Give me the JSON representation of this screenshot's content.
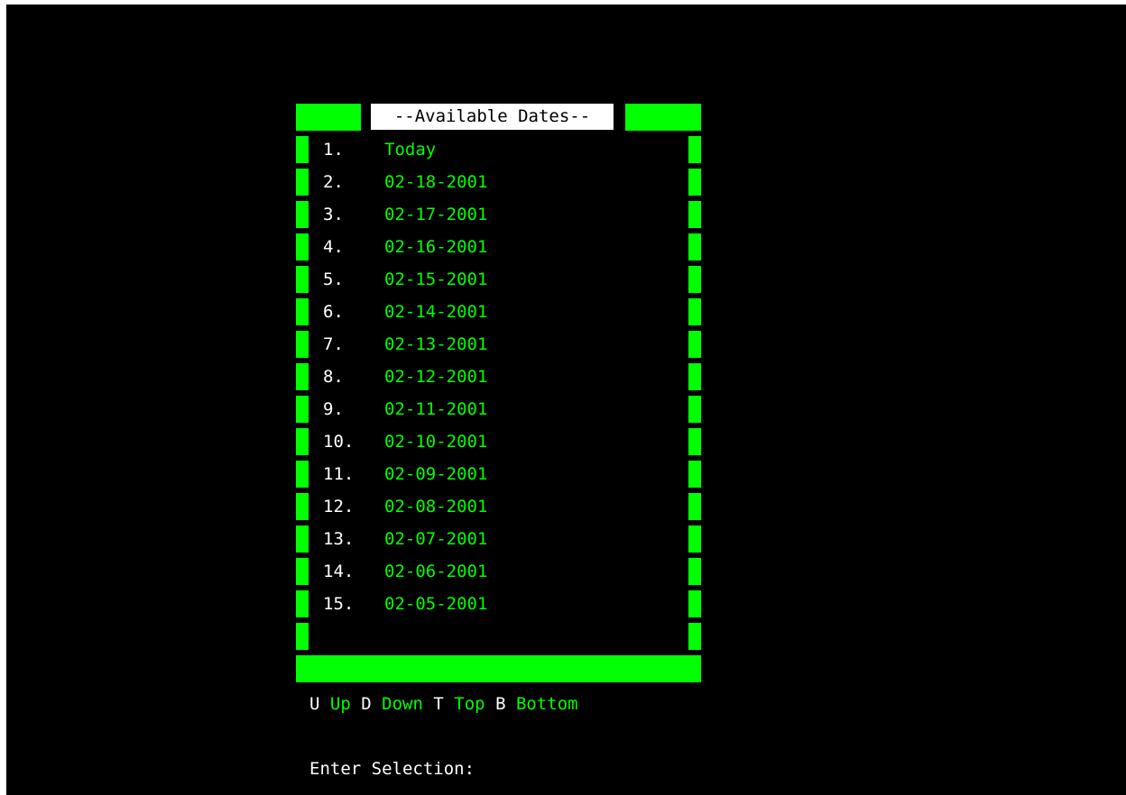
{
  "title": "--Available Dates--",
  "items": [
    {
      "num": "1.",
      "date": "Today"
    },
    {
      "num": "2.",
      "date": "02-18-2001"
    },
    {
      "num": "3.",
      "date": "02-17-2001"
    },
    {
      "num": "4.",
      "date": "02-16-2001"
    },
    {
      "num": "5.",
      "date": "02-15-2001"
    },
    {
      "num": "6.",
      "date": "02-14-2001"
    },
    {
      "num": "7.",
      "date": "02-13-2001"
    },
    {
      "num": "8.",
      "date": "02-12-2001"
    },
    {
      "num": "9.",
      "date": "02-11-2001"
    },
    {
      "num": "10.",
      "date": "02-10-2001"
    },
    {
      "num": "11.",
      "date": "02-09-2001"
    },
    {
      "num": "12.",
      "date": "02-08-2001"
    },
    {
      "num": "13.",
      "date": "02-07-2001"
    },
    {
      "num": "14.",
      "date": "02-06-2001"
    },
    {
      "num": "15.",
      "date": "02-05-2001"
    }
  ],
  "help": [
    {
      "key": "U",
      "action": "Up"
    },
    {
      "key": "D",
      "action": "Down"
    },
    {
      "key": "T",
      "action": "Top"
    },
    {
      "key": "B",
      "action": "Bottom"
    }
  ],
  "prompt": "Enter Selection:",
  "colors": {
    "background": "#000000",
    "accent": "#00ff00",
    "text": "#ffffff"
  }
}
